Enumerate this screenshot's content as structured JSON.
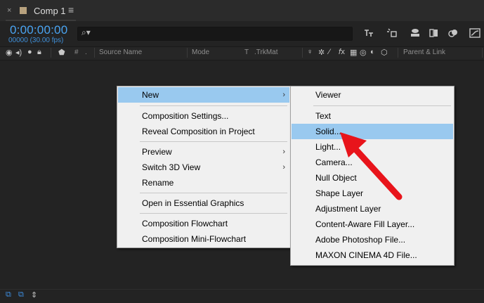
{
  "tab": {
    "close": "×",
    "title": "Comp 1",
    "menu": "≡"
  },
  "timecode": {
    "value": "0:00:00:00",
    "fps": "00000 (30.00 fps)"
  },
  "search": {
    "icon": "⌕▾",
    "value": ""
  },
  "columns": {
    "source_name": "Source Name",
    "mode": "Mode",
    "t": "T",
    "trkmat": ".TrkMat",
    "parent_link": "Parent & Link"
  },
  "main_menu": {
    "items": [
      {
        "label": "New",
        "has_submenu": true,
        "highlighted": true
      },
      {
        "label": "Composition Settings..."
      },
      {
        "label": "Reveal Composition in Project"
      },
      {
        "label": "Preview",
        "has_submenu": true
      },
      {
        "label": "Switch 3D View",
        "has_submenu": true
      },
      {
        "label": "Rename"
      },
      {
        "label": "Open in Essential Graphics"
      },
      {
        "label": "Composition Flowchart"
      },
      {
        "label": "Composition Mini-Flowchart"
      }
    ],
    "arrow": "›"
  },
  "sub_menu": {
    "items": [
      {
        "label": "Viewer"
      },
      {
        "label": "Text"
      },
      {
        "label": "Solid...",
        "highlighted": true
      },
      {
        "label": "Light..."
      },
      {
        "label": "Camera..."
      },
      {
        "label": "Null Object"
      },
      {
        "label": "Shape Layer"
      },
      {
        "label": "Adjustment Layer"
      },
      {
        "label": "Content-Aware Fill Layer..."
      },
      {
        "label": "Adobe Photoshop File..."
      },
      {
        "label": "MAXON CINEMA 4D File..."
      }
    ]
  },
  "colors": {
    "timecode": "#4aa4f2",
    "menu_bg": "#f0f0f0",
    "menu_highlight": "#99c9ef",
    "annotation_arrow": "#e8141b",
    "panel_bg": "#232323"
  },
  "icons": {
    "header_switches": [
      "eye-icon",
      "audio-icon",
      "solo-icon",
      "lock-icon",
      "label-tag-icon",
      "layer-number-icon"
    ],
    "toolbar": [
      "shy-layers-icon",
      "draft-3d-icon",
      "comp-flowchart-icon",
      "frame-blending-icon",
      "motion-blur-icon",
      "graph-editor-icon"
    ],
    "bottom": [
      "layer-switches-icon",
      "transfer-controls-icon",
      "in-out-icon"
    ]
  }
}
